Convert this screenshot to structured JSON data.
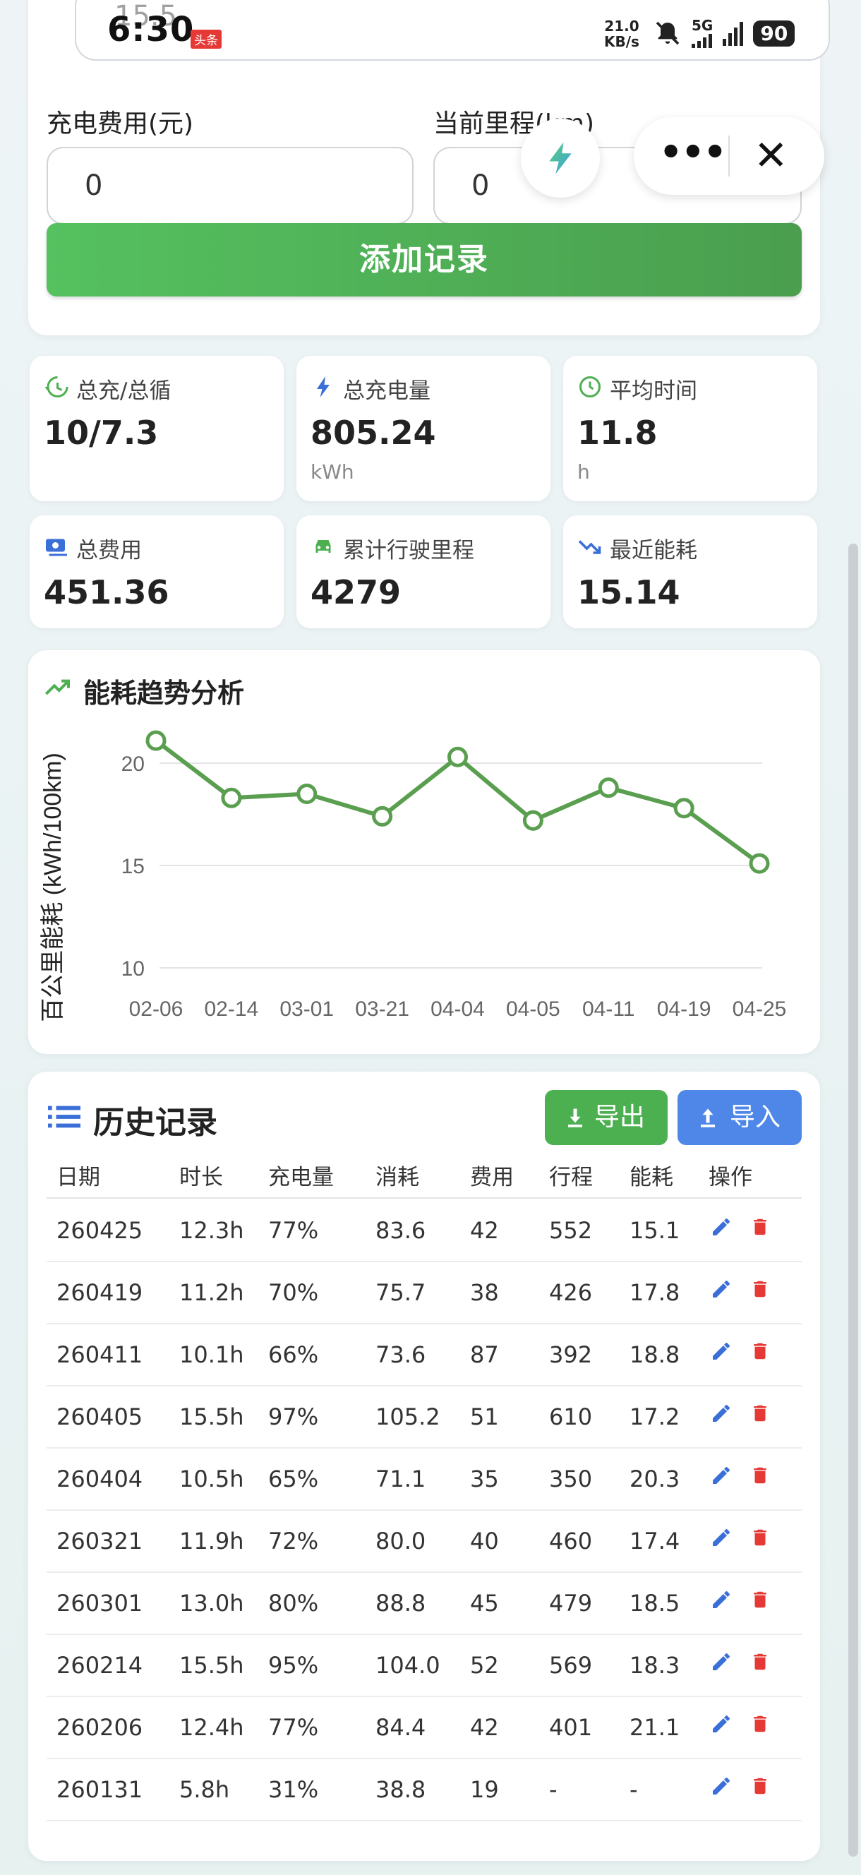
{
  "status_bar": {
    "time": "6:30",
    "time_overlay": "15.5",
    "badge": "头条",
    "speed_value": "21.0",
    "speed_unit": "KB/s",
    "network": "5G",
    "battery": "90"
  },
  "form": {
    "cost_label": "充电费用(元)",
    "cost_value": "0",
    "mileage_label": "当前里程(km)",
    "mileage_value": "0",
    "add_button": "添加记录"
  },
  "stats": [
    {
      "label": "总充/总循",
      "value": "10/7.3",
      "unit": "",
      "icon": "history-icon",
      "color": "#4caf50"
    },
    {
      "label": "总充电量",
      "value": "805.24",
      "unit": "kWh",
      "icon": "bolt-icon",
      "color": "#3b6fd8"
    },
    {
      "label": "平均时间",
      "value": "11.8",
      "unit": "h",
      "icon": "clock-icon",
      "color": "#4caf50"
    },
    {
      "label": "总费用",
      "value": "451.36",
      "unit": "",
      "icon": "money-icon",
      "color": "#3b6fd8"
    },
    {
      "label": "累计行驶里程",
      "value": "4279",
      "unit": "",
      "icon": "car-icon",
      "color": "#4caf50"
    },
    {
      "label": "最近能耗",
      "value": "15.14",
      "unit": "",
      "icon": "trend-down-icon",
      "color": "#3b6fd8"
    }
  ],
  "chart_card": {
    "title": "能耗趋势分析"
  },
  "chart_data": {
    "type": "line",
    "title": "能耗趋势分析",
    "xlabel": "",
    "ylabel": "百公里能耗 (kWh/100km)",
    "categories": [
      "02-06",
      "02-14",
      "03-01",
      "03-21",
      "04-04",
      "04-05",
      "04-11",
      "04-19",
      "04-25"
    ],
    "values": [
      21.1,
      18.3,
      18.5,
      17.4,
      20.3,
      17.2,
      18.8,
      17.8,
      15.1
    ],
    "ylim": [
      10,
      22
    ],
    "yticks": [
      10,
      15,
      20
    ],
    "grid": true,
    "color": "#5a9e4f"
  },
  "history": {
    "title": "历史记录",
    "export_label": "导出",
    "import_label": "导入",
    "columns": [
      "日期",
      "时长",
      "充电量",
      "消耗",
      "费用",
      "行程",
      "能耗",
      "操作"
    ],
    "rows": [
      [
        "260425",
        "12.3h",
        "77%",
        "83.6",
        "42",
        "552",
        "15.1"
      ],
      [
        "260419",
        "11.2h",
        "70%",
        "75.7",
        "38",
        "426",
        "17.8"
      ],
      [
        "260411",
        "10.1h",
        "66%",
        "73.6",
        "87",
        "392",
        "18.8"
      ],
      [
        "260405",
        "15.5h",
        "97%",
        "105.2",
        "51",
        "610",
        "17.2"
      ],
      [
        "260404",
        "10.5h",
        "65%",
        "71.1",
        "35",
        "350",
        "20.3"
      ],
      [
        "260321",
        "11.9h",
        "72%",
        "80.0",
        "40",
        "460",
        "17.4"
      ],
      [
        "260301",
        "13.0h",
        "80%",
        "88.8",
        "45",
        "479",
        "18.5"
      ],
      [
        "260214",
        "15.5h",
        "95%",
        "104.0",
        "52",
        "569",
        "18.3"
      ],
      [
        "260206",
        "12.4h",
        "77%",
        "84.4",
        "42",
        "401",
        "21.1"
      ],
      [
        "260131",
        "5.8h",
        "31%",
        "38.8",
        "19",
        "-",
        "-"
      ]
    ]
  }
}
